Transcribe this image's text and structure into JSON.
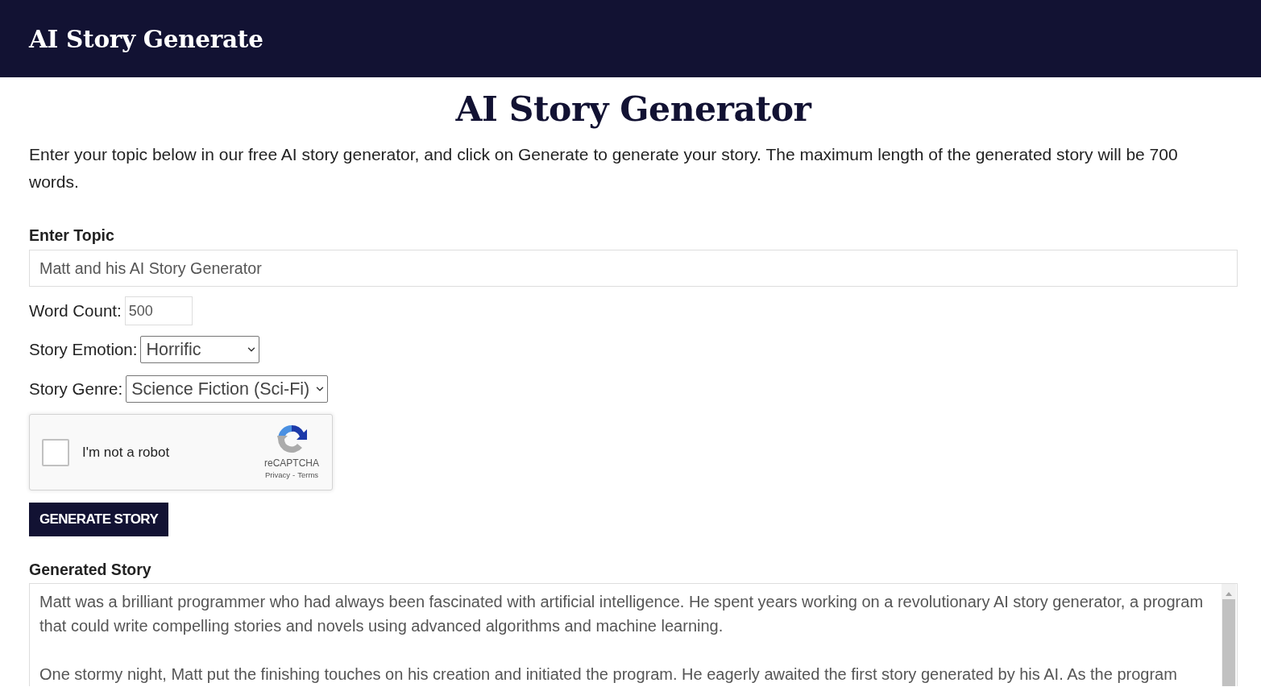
{
  "header": {
    "title": "AI Story Generate"
  },
  "intro": {
    "heading": "AI Story Generator",
    "text": "Enter your topic below in our free AI story generator, and click on Generate to generate your story. The maximum length of the generated story will be 700 words."
  },
  "form": {
    "topic": {
      "label": "Enter Topic",
      "value": "Matt and his AI Story Generator"
    },
    "word_count": {
      "label": "Word Count:",
      "value": "500"
    },
    "selects": [
      {
        "label": "Story Emotion:",
        "value": "Horrific"
      },
      {
        "label": "Story Genre:",
        "value": "Science Fiction (Sci-Fi)"
      }
    ],
    "captcha": {
      "label": "I'm not a robot",
      "checked": false,
      "brand": "reCAPTCHA",
      "links": [
        "Privacy",
        "Terms"
      ],
      "separator": "-"
    },
    "submit_button": "GENERATE STORY"
  },
  "output": {
    "label": "Generated Story",
    "paragraphs": [
      "Matt was a brilliant programmer who had always been fascinated with artificial intelligence. He spent years working on a revolutionary AI story generator, a program that could write compelling stories and novels using advanced algorithms and machine learning.",
      "One stormy night, Matt put the finishing touches on his creation and initiated the program. He eagerly awaited the first story generated by his AI. As the program"
    ]
  }
}
